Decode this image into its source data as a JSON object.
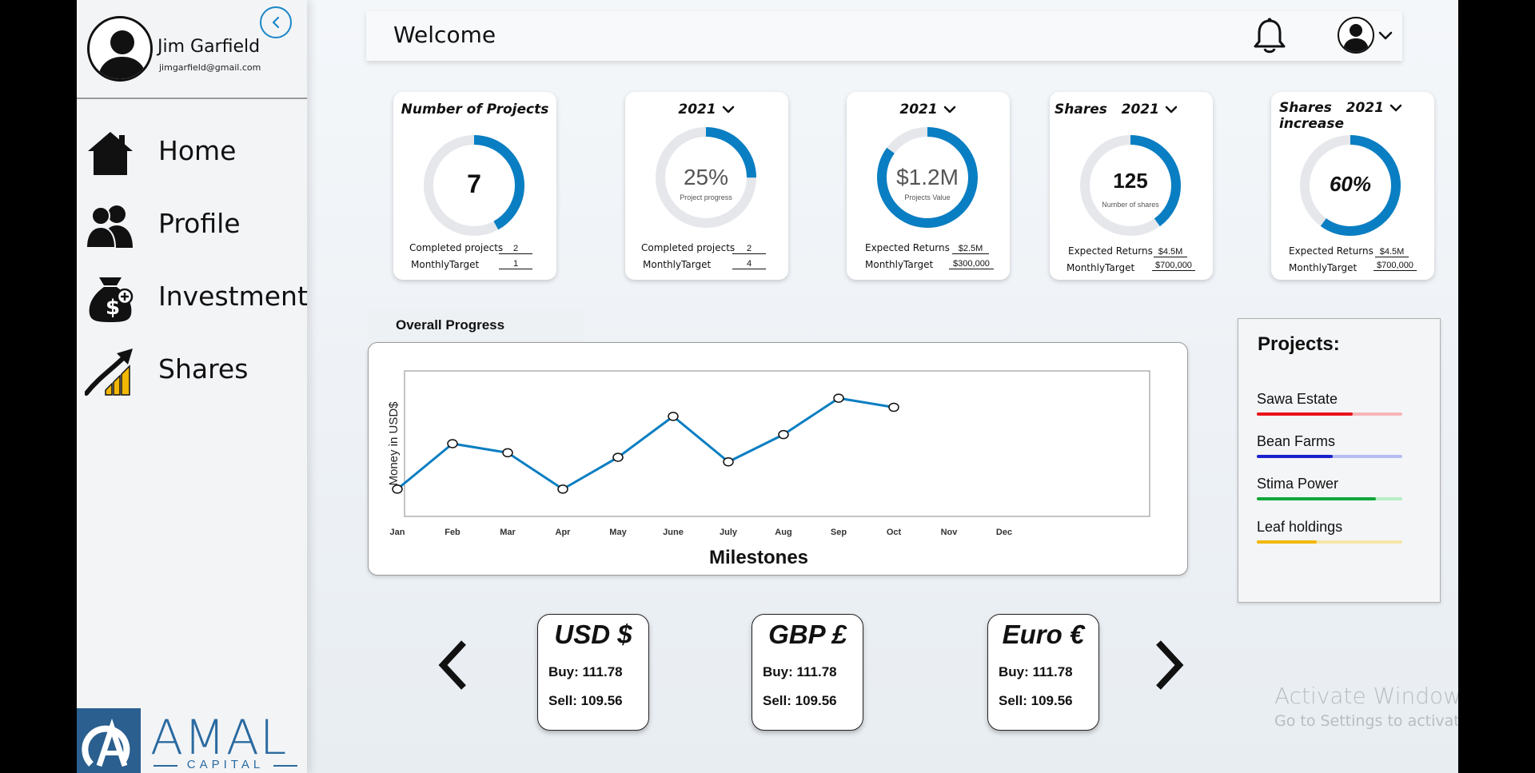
{
  "user": {
    "name": "Jim Garfield",
    "email": "jimgarfield@gmail.com"
  },
  "sidebar": {
    "items": [
      {
        "label": "Home",
        "icon": "home-icon"
      },
      {
        "label": "Profile",
        "icon": "users-icon"
      },
      {
        "label": "Investment",
        "icon": "money-bag-icon"
      },
      {
        "label": "Shares",
        "icon": "growth-arrow-icon"
      }
    ]
  },
  "brand": {
    "name": "AMAL",
    "sub": "CAPITAL"
  },
  "header": {
    "title": "Welcome"
  },
  "colors": {
    "accent": "#0a7ec2",
    "track": "#e5e7eb"
  },
  "cards": [
    {
      "title": "Number of Projects",
      "value": "7",
      "progress": 0.42,
      "rows": [
        {
          "label": "Completed projects",
          "value": "2"
        },
        {
          "label": "MonthlyTarget",
          "value": "1"
        }
      ]
    },
    {
      "year": "2021",
      "value": "25%",
      "sub": "Project progress",
      "progress": 0.25,
      "rows": [
        {
          "label": "Completed projects",
          "value": "2"
        },
        {
          "label": "MonthlyTarget",
          "value": "4"
        }
      ]
    },
    {
      "year": "2021",
      "value": "$1.2M",
      "sub": "Projects Value",
      "progress": 0.85,
      "rows": [
        {
          "label": "Expected Returns",
          "value": "$2.5M"
        },
        {
          "label": "MonthlyTarget",
          "value": "$300,000"
        }
      ]
    },
    {
      "title": "Shares",
      "year": "2021",
      "value": "125",
      "sub": "Number of shares",
      "progress": 0.4,
      "rows": [
        {
          "label": "Expected Returns",
          "value": "$4.5M"
        },
        {
          "label": "MonthlyTarget",
          "value": "$700,000"
        }
      ]
    },
    {
      "title": "Shares",
      "title2": "increase",
      "year": "2021",
      "value": "60%",
      "progress": 0.6,
      "rows": [
        {
          "label": "Expected Returns",
          "value": "$4.5M"
        },
        {
          "label": "MonthlyTarget",
          "value": "$700,000"
        }
      ]
    }
  ],
  "chart_tab": "Overall Progress",
  "chart_data": {
    "type": "line",
    "categories": [
      "Jan",
      "Feb",
      "Mar",
      "Apr",
      "May",
      "June",
      "July",
      "Aug",
      "Sep",
      "Oct",
      "Nov",
      "Dec"
    ],
    "series": [
      {
        "values": [
          1,
          6,
          5,
          1,
          4.5,
          9,
          4,
          7,
          11,
          10
        ]
      }
    ],
    "xlabel": "Milestones",
    "ylabel": "Money in USD$",
    "ylim": [
      -2,
      14
    ],
    "grid": false,
    "color": "#0a7ec2"
  },
  "projects": {
    "title": "Projects:",
    "items": [
      {
        "name": "Sawa Estate",
        "progress": 0.66,
        "color": "#e8141c",
        "track": "#f7b5b8"
      },
      {
        "name": "Bean Farms",
        "progress": 0.52,
        "color": "#1a22cc",
        "track": "#b6bdf5"
      },
      {
        "name": "Stima Power",
        "progress": 0.82,
        "color": "#12a63a",
        "track": "#b7efc4"
      },
      {
        "name": "Leaf holdings",
        "progress": 0.41,
        "color": "#f2b705",
        "track": "#f6e6a8"
      }
    ]
  },
  "currencies": [
    {
      "name": "USD $",
      "buy": "Buy: 111.78",
      "sell": "Sell: 109.56"
    },
    {
      "name": "GBP £",
      "buy": "Buy: 111.78",
      "sell": "Sell: 109.56"
    },
    {
      "name": "Euro €",
      "buy": "Buy: 111.78",
      "sell": "Sell: 109.56"
    }
  ],
  "watermark": {
    "line1": "Activate Windows",
    "line2": "Go to Settings to activate Windows."
  }
}
